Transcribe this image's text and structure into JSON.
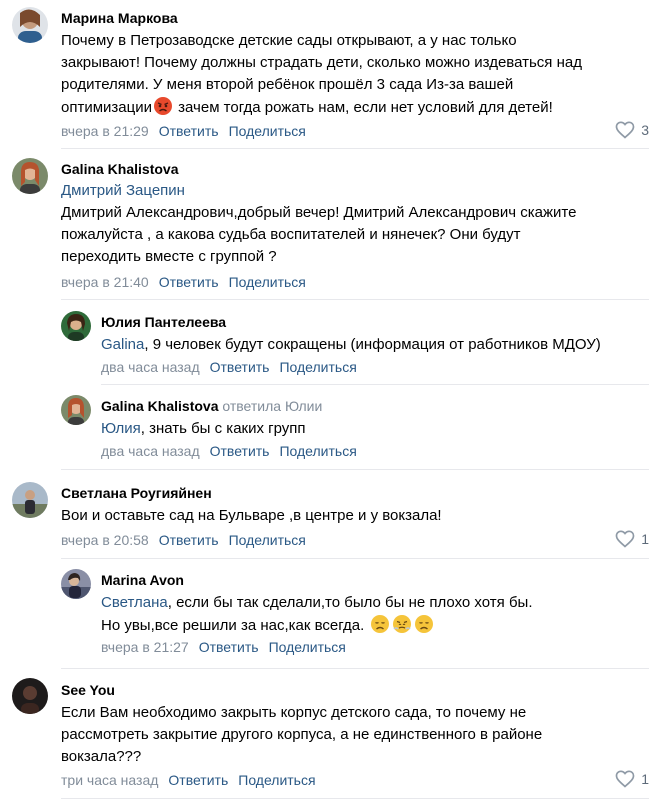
{
  "comments": [
    {
      "author": "Марина Маркова",
      "lines": [
        "Почему в Петрозаводске детские сады открывают, а у нас только",
        "закрывают! Почему должны страдать дети, сколько можно издеваться над",
        "родителями. У меня второй ребёнок прошёл 3 сада Из-за вашей",
        "оптимизации",
        " зачем тогда рожать нам, если нет условий для детей!"
      ],
      "emoji": "angry-face",
      "time": "вчера в 21:29",
      "likes": "3"
    },
    {
      "author": "Galina Khalistova",
      "mention": "Дмитрий Зацепин",
      "lines": [
        "Дмитрий Александрович,добрый вечер! Дмитрий Александрович скажите",
        "пожалуйста , а какова судьба воспитателей и нянечек? Они будут",
        "переходить вместе с группой ?"
      ],
      "time": "вчера в 21:40"
    },
    {
      "author": "Юлия Пантелеева",
      "mention": "Galina",
      "text": ", 9 человек будут сокращены (информация от работников МДОУ)",
      "time": "два часа назад"
    },
    {
      "author": "Galina Khalistova",
      "replied": "ответила Юлии",
      "mention": "Юлия",
      "text": ", знать бы с каких групп",
      "time": "два часа назад"
    },
    {
      "author": "Светлана Роугияйнен",
      "text": "Вои и оставьте сад на Бульваре ,в центре и у вокзала!",
      "time": "вчера в 20:58",
      "likes": "1"
    },
    {
      "author": "Marina Avon",
      "mention": "Светлана",
      "line1": ", если бы так сделали,то было бы не плохо хотя бы.",
      "line2": "Но увы,все решили за нас,как всегда.",
      "emojis": [
        "disappointed-face",
        "steam-from-nose-face",
        "disappointed-face"
      ],
      "time": "вчера в 21:27"
    },
    {
      "author": "See You",
      "lines": [
        "Если Вам необходимо закрыть корпус детского сада, то почему не",
        "рассмотреть закрытие другого корпуса, а не единственного в районе",
        "вокзала???"
      ],
      "time": "три часа назад",
      "likes": "1"
    }
  ],
  "actions": {
    "reply": "Ответить",
    "share": "Поделиться"
  },
  "icons": {
    "like": "heart-outline-icon"
  },
  "colors": {
    "link": "#2a5885",
    "meta": "#818c99",
    "divider": "#e7e8ec"
  }
}
